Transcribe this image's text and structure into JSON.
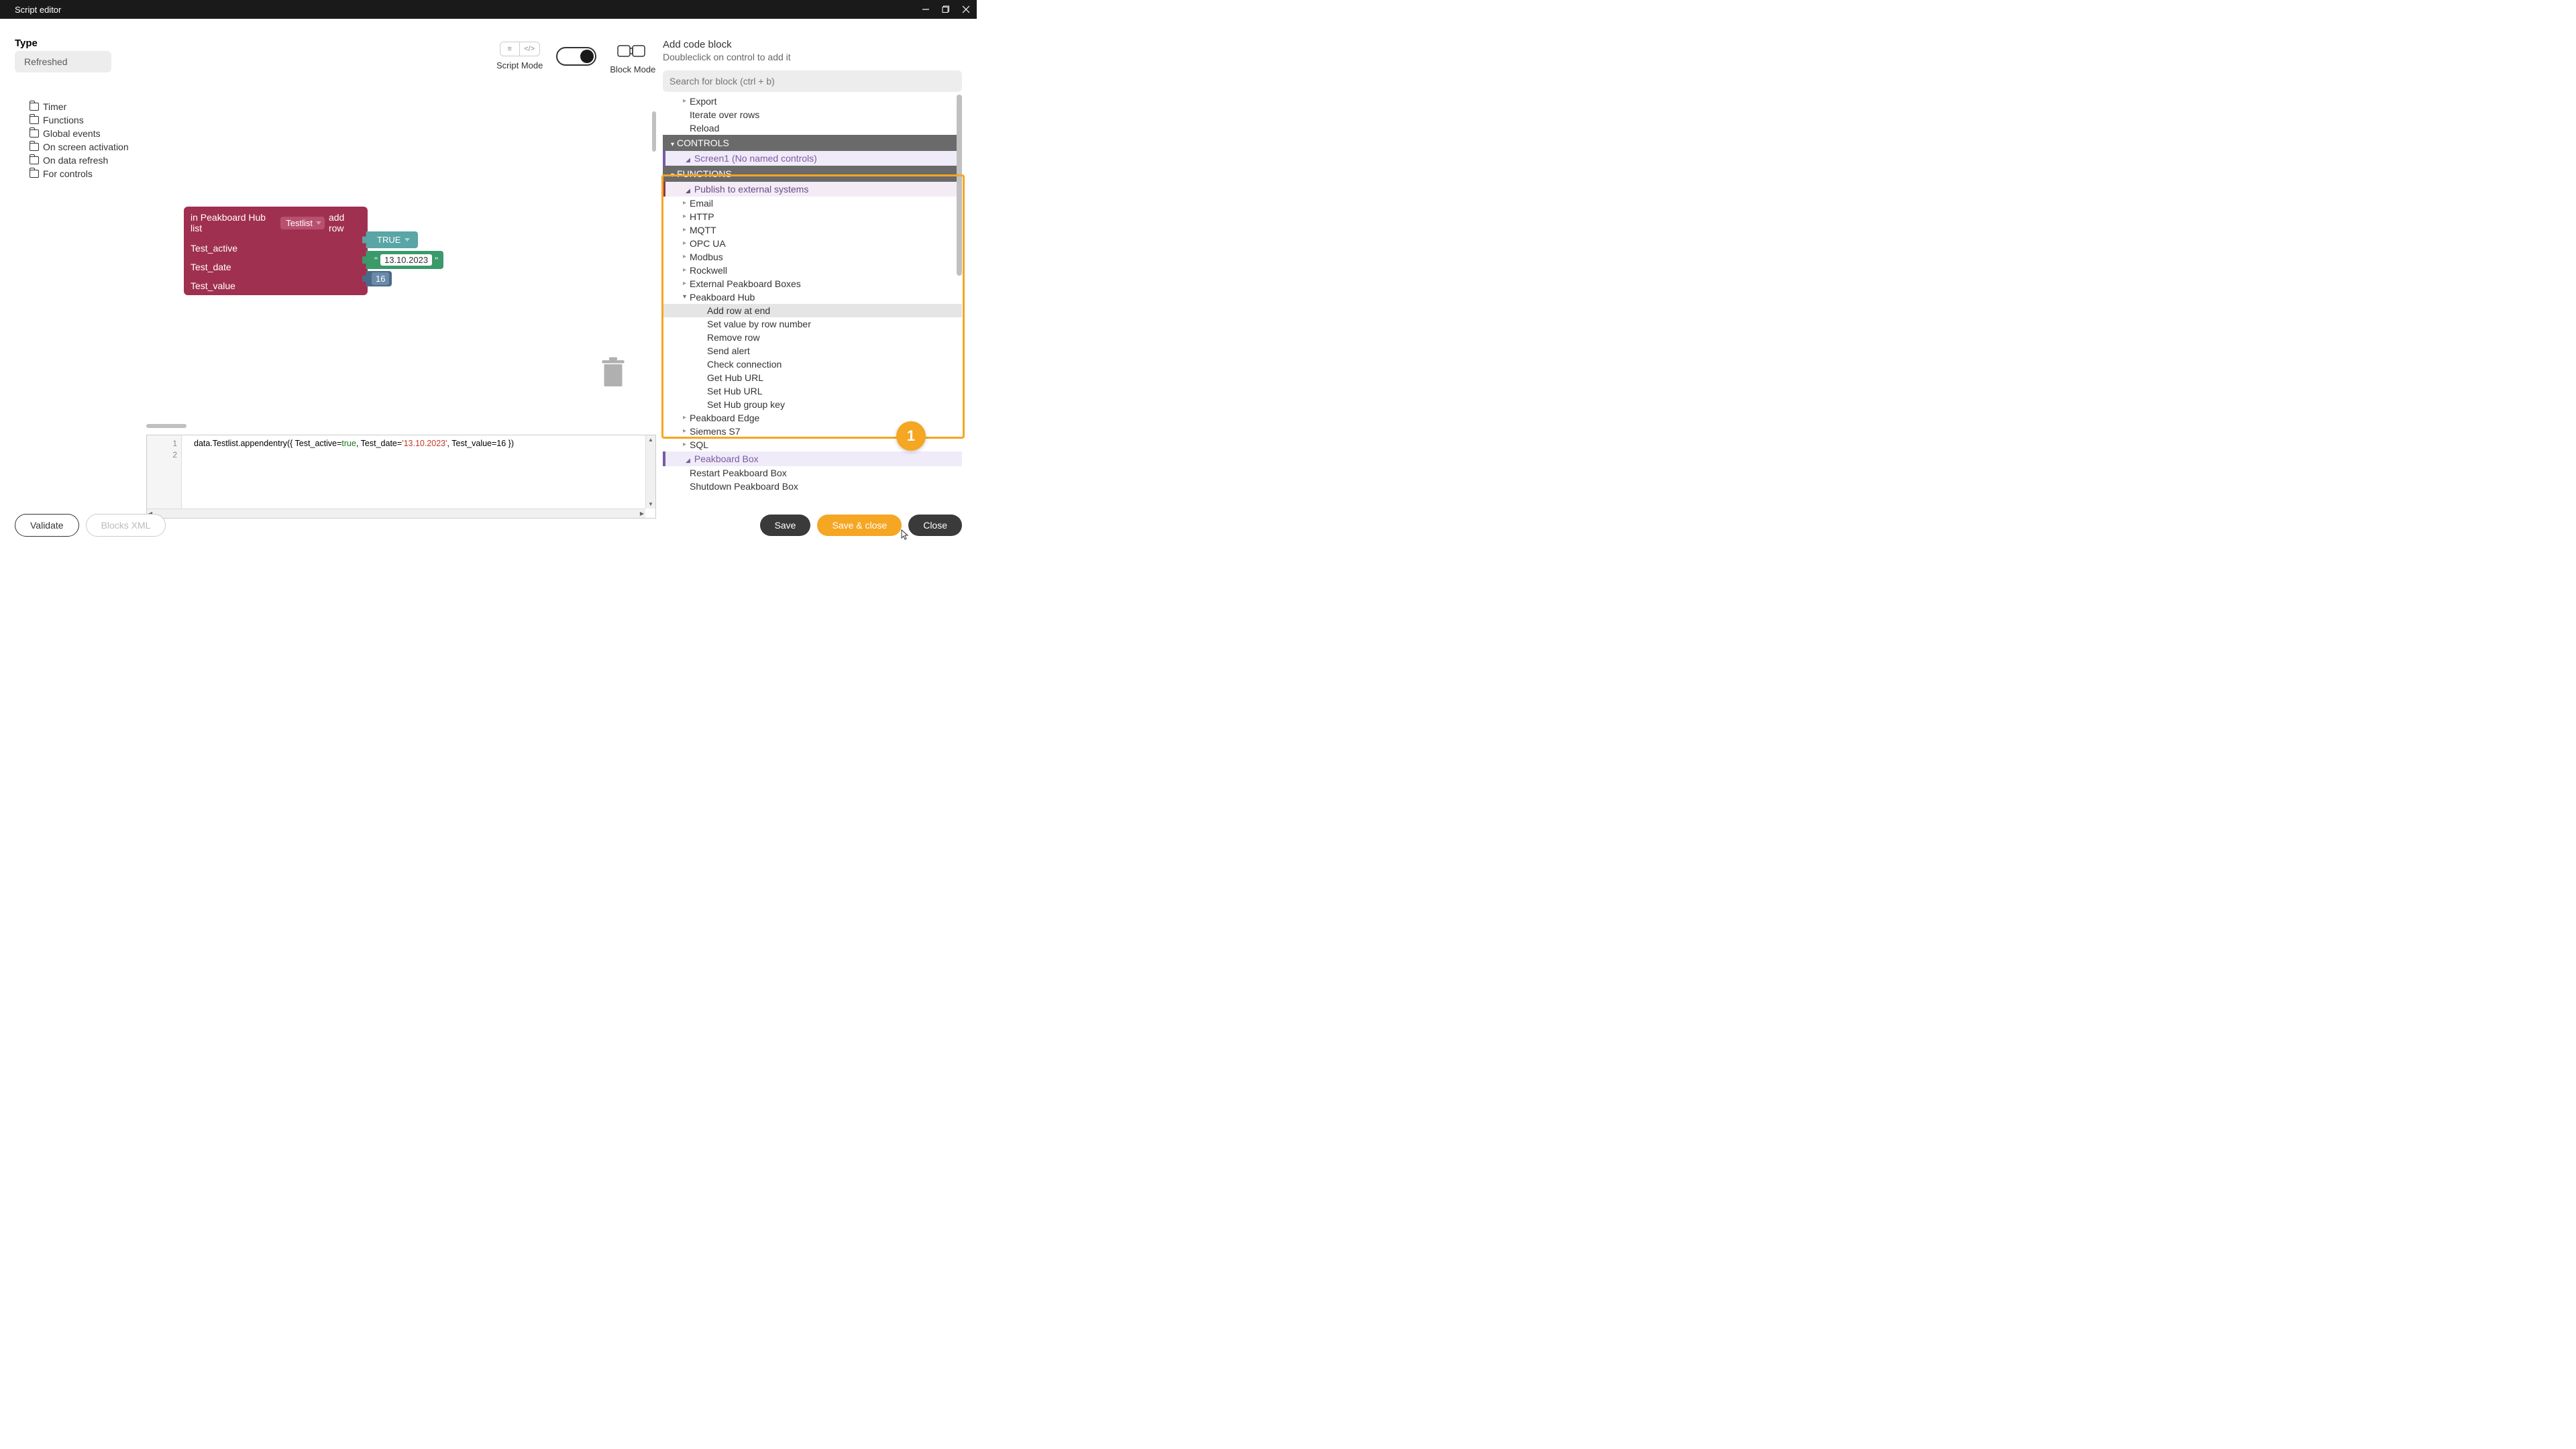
{
  "window": {
    "title": "Script editor"
  },
  "type": {
    "label": "Type",
    "value": "Refreshed"
  },
  "modes": {
    "script": "Script Mode",
    "block": "Block Mode"
  },
  "tree": {
    "items": [
      "Timer",
      "Functions",
      "Global events",
      "On screen activation",
      "On data refresh",
      "For controls"
    ]
  },
  "block": {
    "prefix": "in Peakboard Hub list",
    "list": "Testlist",
    "suffix": "add row",
    "rows": [
      {
        "label": "Test_active",
        "value": "TRUE"
      },
      {
        "label": "Test_date",
        "value": "13.10.2023"
      },
      {
        "label": "Test_value",
        "value": "16"
      }
    ]
  },
  "code": {
    "line1_pre": "data.Testlist.appendentry({ Test_active=",
    "line1_true": "true",
    "line1_mid": ", Test_date=",
    "line1_str": "'13.10.2023'",
    "line1_post": ", Test_value=16 })"
  },
  "rightPanel": {
    "title": "Add code block",
    "subtitle": "Doubleclick on control to add it",
    "searchPlaceholder": "Search for block (ctrl + b)",
    "topItems": [
      "Export",
      "Iterate over rows",
      "Reload"
    ],
    "controls": {
      "header": "CONTROLS",
      "screen": "Screen1 (No named controls)"
    },
    "functions": {
      "header": "FUNCTIONS",
      "publish": "Publish to external systems",
      "items": [
        "Email",
        "HTTP",
        "MQTT",
        "OPC UA",
        "Modbus",
        "Rockwell",
        "External Peakboard Boxes"
      ],
      "peakboardHub": "Peakboard Hub",
      "hubItems": [
        "Add row at end",
        "Set value by row number",
        "Remove row",
        "Send alert",
        "Check connection",
        "Get Hub URL",
        "Set Hub URL",
        "Set Hub group key"
      ],
      "afterHub": [
        "Peakboard Edge",
        "Siemens S7",
        "SQL"
      ],
      "peakboardBox": "Peakboard Box",
      "boxItems": [
        "Restart Peakboard Box",
        "Shutdown Peakboard Box"
      ]
    }
  },
  "footer": {
    "validate": "Validate",
    "blocksXml": "Blocks XML",
    "save": "Save",
    "saveClose": "Save & close",
    "close": "Close"
  },
  "badge1": "1"
}
